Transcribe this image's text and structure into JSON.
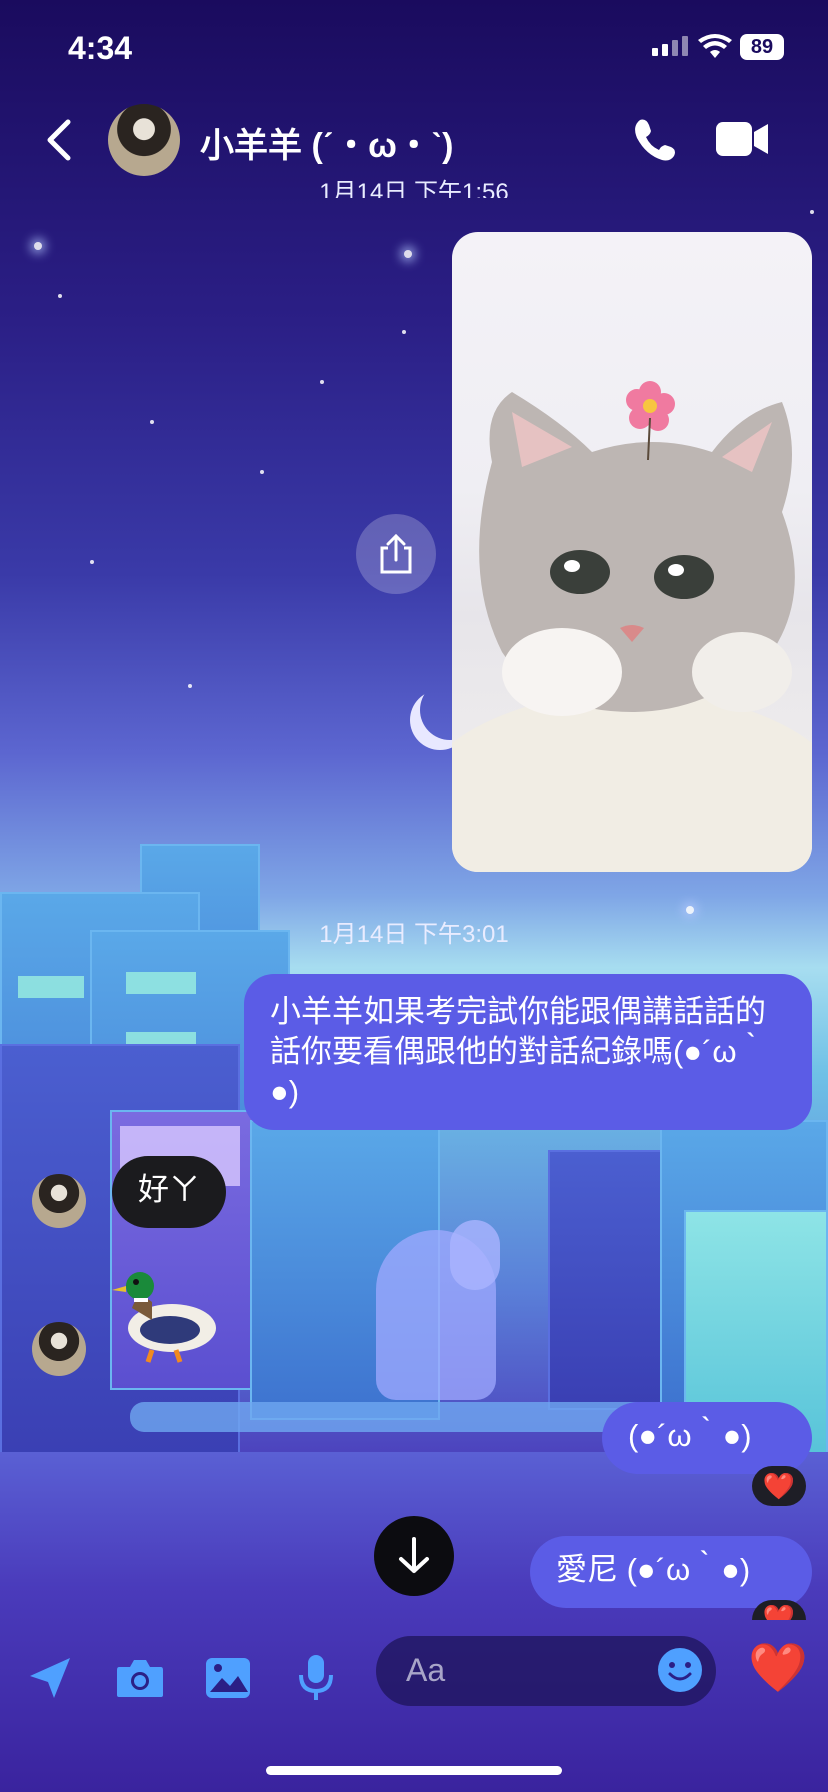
{
  "status_bar": {
    "time": "4:34",
    "battery": "89"
  },
  "header": {
    "contact_name": "小羊羊 (ˊ・ω・ˋ)"
  },
  "messages": {
    "timestamp_top": "1月14日 下午1:56",
    "timestamp_mid": "1月14日 下午3:01",
    "outgoing_long": "小羊羊如果考完試你能跟偶講話話的話你要看偶跟他的對話紀錄嗎(●´ω｀●)",
    "incoming_reply": "好ㄚ",
    "outgoing_emoticon": "(●´ω｀●)",
    "outgoing_last": "愛尼 (●´ω｀●)",
    "reaction": "❤️"
  },
  "composer": {
    "placeholder": "Aa",
    "like": "❤️"
  },
  "colors": {
    "outgoing_bubble": "#5b5ce6",
    "incoming_bubble": "#1b1b1e"
  },
  "icons": [
    "back-icon",
    "phone-icon",
    "video-icon",
    "share-icon",
    "duck-sticker",
    "arrow-down-icon",
    "location-icon",
    "camera-icon",
    "gallery-icon",
    "microphone-icon",
    "emoji-icon",
    "heart-icon"
  ]
}
